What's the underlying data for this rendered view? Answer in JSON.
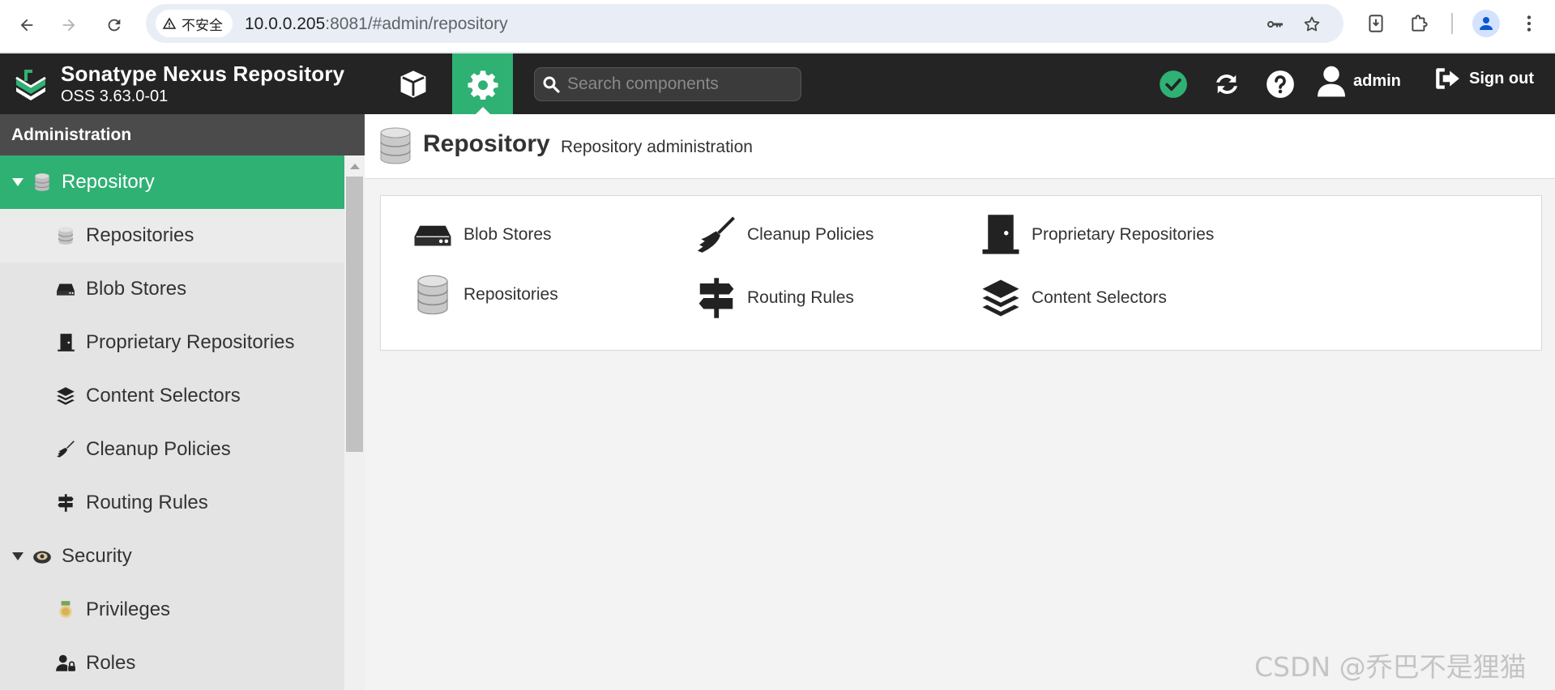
{
  "browser": {
    "security_label": "不安全",
    "url_host": "10.0.0.205",
    "url_rest": ":8081/#admin/repository"
  },
  "header": {
    "brand_name": "Sonatype Nexus Repository",
    "brand_version": "OSS 3.63.0-01",
    "search_placeholder": "Search components",
    "user_label": "admin",
    "signout_label": "Sign out",
    "accent_color": "#2fb174"
  },
  "sidebar": {
    "title": "Administration",
    "items": [
      {
        "label": "Repository",
        "level": 0,
        "state": "active"
      },
      {
        "label": "Repositories",
        "level": 1,
        "state": "selected"
      },
      {
        "label": "Blob Stores",
        "level": 1
      },
      {
        "label": "Proprietary Repositories",
        "level": 1
      },
      {
        "label": "Content Selectors",
        "level": 1
      },
      {
        "label": "Cleanup Policies",
        "level": 1
      },
      {
        "label": "Routing Rules",
        "level": 1
      },
      {
        "label": "Security",
        "level": 0
      },
      {
        "label": "Privileges",
        "level": 1
      },
      {
        "label": "Roles",
        "level": 1
      }
    ]
  },
  "main": {
    "title": "Repository",
    "subtitle": "Repository administration",
    "features": [
      {
        "label": "Blob Stores",
        "icon": "hdd-icon"
      },
      {
        "label": "Cleanup Policies",
        "icon": "broom-icon"
      },
      {
        "label": "Proprietary Repositories",
        "icon": "door-icon"
      },
      {
        "label": "Repositories",
        "icon": "database-icon"
      },
      {
        "label": "Routing Rules",
        "icon": "signpost-icon"
      },
      {
        "label": "Content Selectors",
        "icon": "layers-icon"
      }
    ]
  },
  "watermark": "CSDN @乔巴不是狸猫"
}
